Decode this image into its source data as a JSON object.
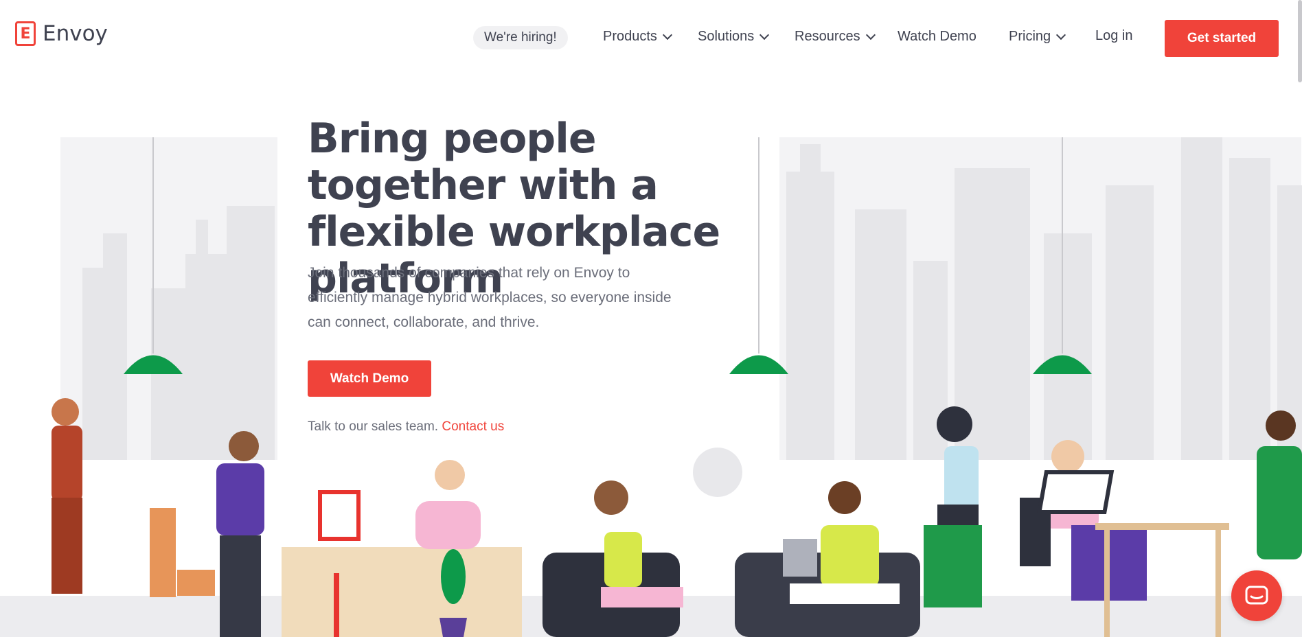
{
  "brand": {
    "name": "Envoy",
    "logo_letter": "E",
    "accent": "#f0433a"
  },
  "nav": {
    "hiring": "We're hiring!",
    "products": "Products",
    "solutions": "Solutions",
    "resources": "Resources",
    "watch_demo": "Watch Demo",
    "pricing": "Pricing",
    "login": "Log in",
    "get_started": "Get started"
  },
  "hero": {
    "title": "Bring people together with a flexible workplace platform",
    "subtitle": "Join thousands of companies that rely on Envoy to efficiently manage hybrid workplaces, so everyone inside can connect, collaborate, and thrive.",
    "cta": "Watch Demo",
    "sales_text": "Talk to our sales team.",
    "contact_link": "Contact us"
  },
  "colors": {
    "lamp": "#0d9a4a",
    "building": "#ececee",
    "building_dark": "#e3e3e6",
    "text": "#3f4250"
  },
  "icons": {
    "chat": "chat-bubble-icon",
    "chevron": "chevron-down-icon"
  }
}
